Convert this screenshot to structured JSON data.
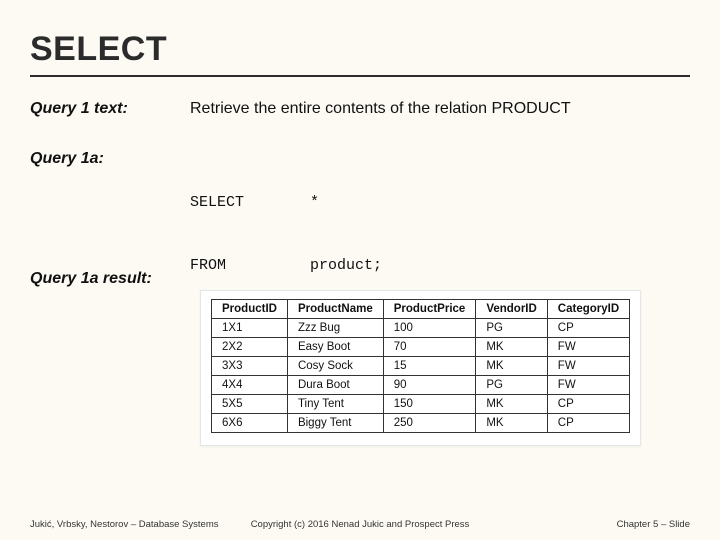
{
  "title": "SELECT",
  "q1text_label": "Query 1 text:",
  "q1text_desc": "Retrieve the entire contents of the relation PRODUCT",
  "q1a_label": "Query 1a:",
  "code_select_kw": "SELECT",
  "code_select_arg": "*",
  "code_from_kw": "FROM",
  "code_from_arg": "product;",
  "result_label": "Query 1a result:",
  "chart_data": {
    "type": "table",
    "columns": [
      "ProductID",
      "ProductName",
      "ProductPrice",
      "VendorID",
      "CategoryID"
    ],
    "rows": [
      [
        "1X1",
        "Zzz Bug",
        "100",
        "PG",
        "CP"
      ],
      [
        "2X2",
        "Easy Boot",
        "70",
        "MK",
        "FW"
      ],
      [
        "3X3",
        "Cosy Sock",
        "15",
        "MK",
        "FW"
      ],
      [
        "4X4",
        "Dura Boot",
        "90",
        "PG",
        "FW"
      ],
      [
        "5X5",
        "Tiny Tent",
        "150",
        "MK",
        "CP"
      ],
      [
        "6X6",
        "Biggy Tent",
        "250",
        "MK",
        "CP"
      ]
    ]
  },
  "footer_left": "Jukić, Vrbsky, Nestorov – Database Systems",
  "footer_center": "Copyright (c) 2016 Nenad Jukic and Prospect Press",
  "footer_right": "Chapter 5 – Slide"
}
